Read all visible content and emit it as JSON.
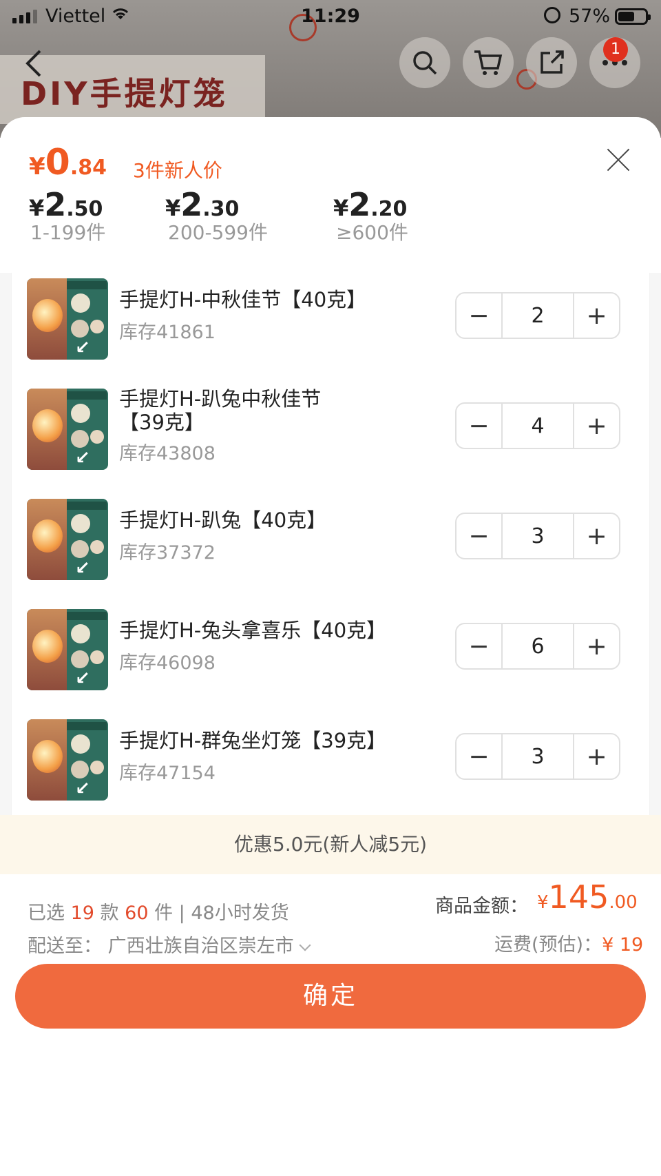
{
  "status_bar": {
    "carrier": "Viettel",
    "time": "11:29",
    "battery": "57%"
  },
  "background": {
    "banner_text": "DIY手提灯笼",
    "cart_badge": "1"
  },
  "sheet": {
    "main_price": {
      "yen": "¥",
      "int": "0",
      "dec": ".84",
      "tag": "3件新人价"
    },
    "tiers": [
      {
        "yen": "¥",
        "int": "2",
        "dec": ".50",
        "range": "1-199件"
      },
      {
        "yen": "¥",
        "int": "2",
        "dec": ".30",
        "range": "200-599件"
      },
      {
        "yen": "¥",
        "int": "2",
        "dec": ".20",
        "range": "≥600件"
      }
    ],
    "items": [
      {
        "name": "手提灯H-中秋佳节【40克】",
        "stock": "库存41861",
        "qty": "2"
      },
      {
        "name": "手提灯H-趴兔中秋佳节【39克】",
        "stock": "库存43808",
        "qty": "4"
      },
      {
        "name": "手提灯H-趴兔【40克】",
        "stock": "库存37372",
        "qty": "3"
      },
      {
        "name": "手提灯H-兔头拿喜乐【40克】",
        "stock": "库存46098",
        "qty": "6"
      },
      {
        "name": "手提灯H-群兔坐灯笼【39克】",
        "stock": "库存47154",
        "qty": "3"
      }
    ],
    "stepper_minus": "−",
    "stepper_plus": "+",
    "discount": "优惠5.0元(新人减5元)",
    "footer": {
      "selected_prefix": "已选",
      "kinds": "19",
      "kinds_unit": "款",
      "pieces": "60",
      "pieces_unit": "件 | 48小时发货",
      "deliver_label": "配送至：",
      "deliver_value": "广西壮族自治区崇左市",
      "amount_label": "商品金额：",
      "amount_yen": "¥",
      "amount_int": "145",
      "amount_dec": ".00",
      "ship_label": "运费(预估)：",
      "ship_value": "¥ 19",
      "confirm": "确定"
    }
  }
}
